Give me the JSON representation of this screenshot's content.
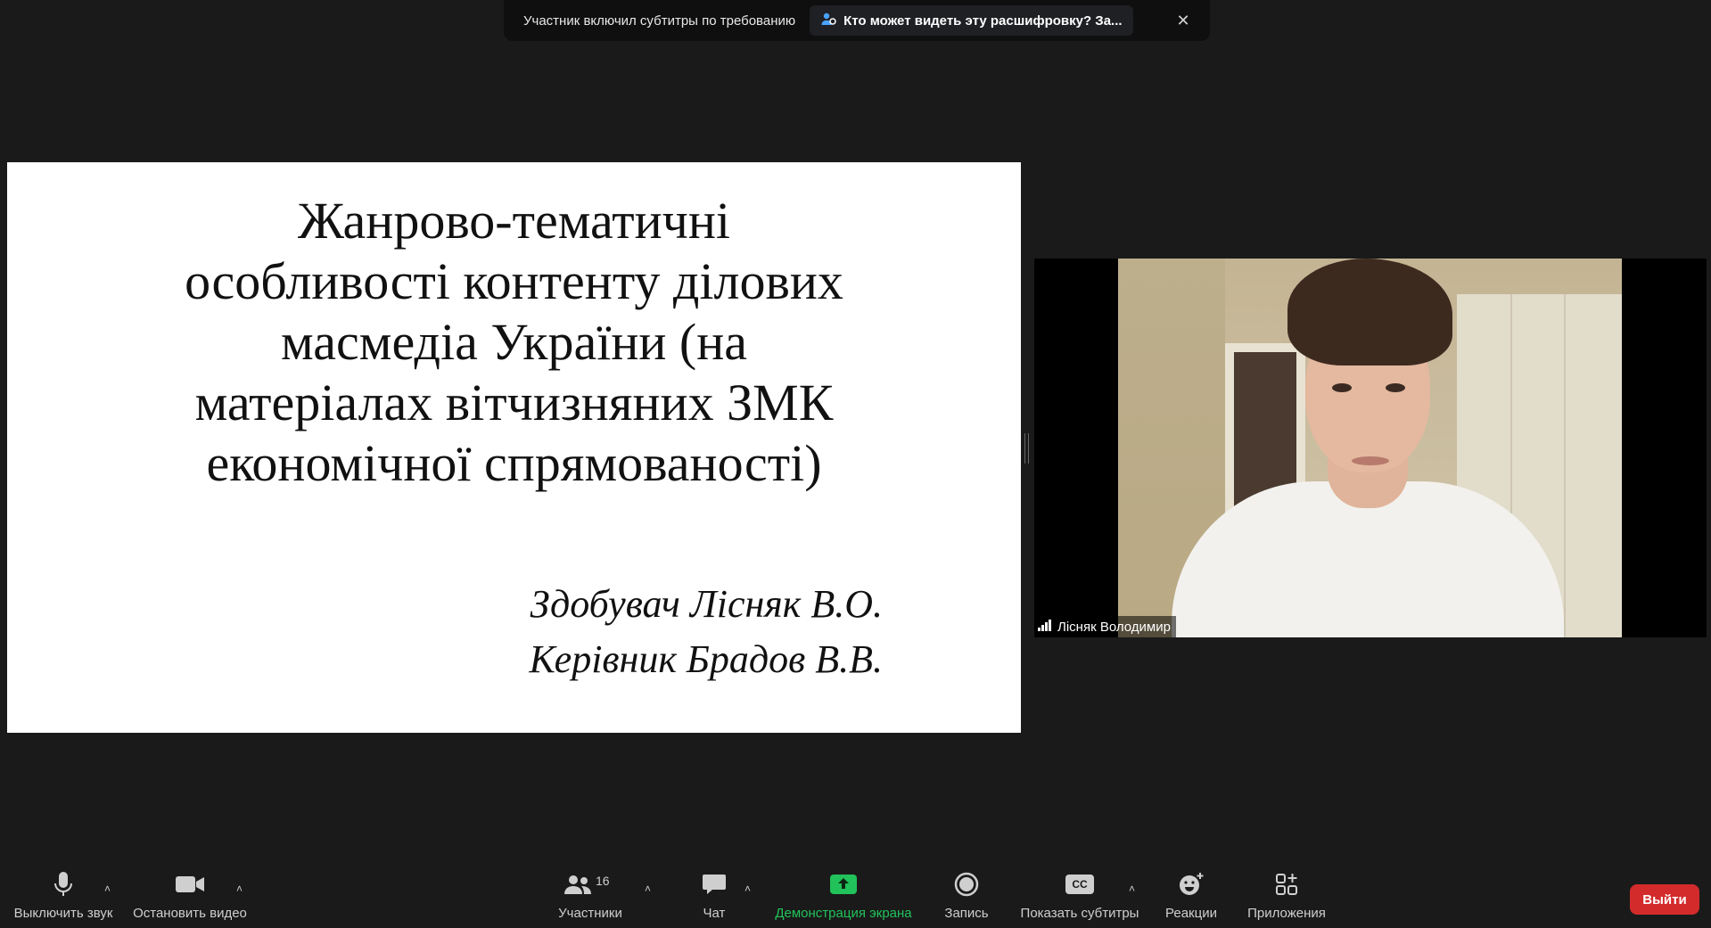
{
  "banner": {
    "text": "Участник включил субтитры по требованию",
    "link_label": "Кто может видеть эту расшифровку? За...",
    "close_glyph": "✕"
  },
  "slide": {
    "title": "Жанрово-тематичні\nособливості контенту ділових\nмасмедіа України (на\nматеріалах вітчизняних ЗМК\nекономічної спрямованості)",
    "author_line1": "Здобувач Лісняк В.О.",
    "author_line2": "Керівник Брадов В.В."
  },
  "video": {
    "participant_name": "Лісняк Володимир"
  },
  "toolbar": {
    "mute_label": "Выключить звук",
    "video_label": "Остановить видео",
    "participants_label": "Участники",
    "participants_count": "16",
    "chat_label": "Чат",
    "share_label": "Демонстрация экрана",
    "record_label": "Запись",
    "captions_label": "Показать субтитры",
    "captions_icon_text": "CC",
    "reactions_label": "Реакции",
    "apps_label": "Приложения",
    "leave_label": "Выйти",
    "caret_glyph": "˄"
  },
  "colors": {
    "background": "#1a1a1a",
    "share_accent": "#22c25a",
    "leave_button": "#d32b2b"
  }
}
